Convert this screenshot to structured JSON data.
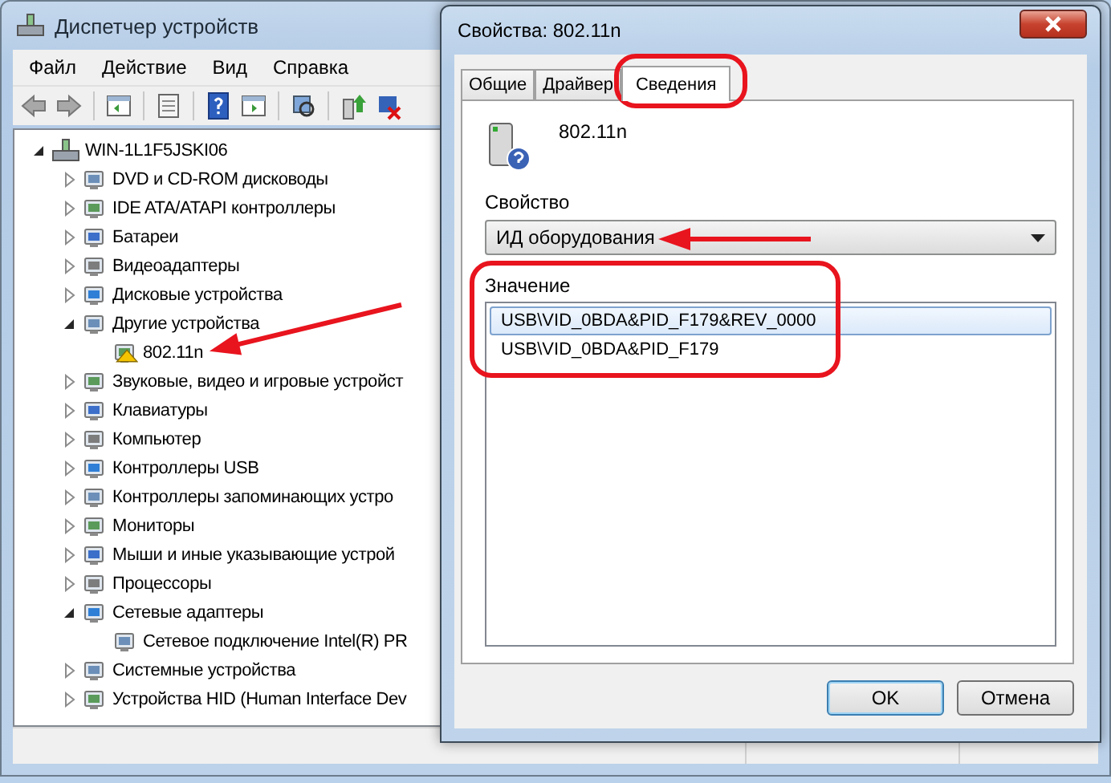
{
  "main_window": {
    "title": "Диспетчер устройств",
    "menu": [
      "Файл",
      "Действие",
      "Вид",
      "Справка"
    ],
    "tree": {
      "label": "WIN-1L1F5JSKI06",
      "expanded": true,
      "children": [
        {
          "label": "DVD и CD-ROM дисководы",
          "expanded": false
        },
        {
          "label": "IDE ATA/ATAPI контроллеры",
          "expanded": false
        },
        {
          "label": "Батареи",
          "expanded": false
        },
        {
          "label": "Видеоадаптеры",
          "expanded": false
        },
        {
          "label": "Дисковые устройства",
          "expanded": false
        },
        {
          "label": "Другие устройства",
          "expanded": true,
          "children": [
            {
              "label": "802.11n",
              "warning": true
            }
          ]
        },
        {
          "label": "Звуковые, видео и игровые устройст",
          "expanded": false
        },
        {
          "label": "Клавиатуры",
          "expanded": false
        },
        {
          "label": "Компьютер",
          "expanded": false
        },
        {
          "label": "Контроллеры USB",
          "expanded": false
        },
        {
          "label": "Контроллеры запоминающих устро",
          "expanded": false
        },
        {
          "label": "Мониторы",
          "expanded": false
        },
        {
          "label": "Мыши и иные указывающие устрой",
          "expanded": false
        },
        {
          "label": "Процессоры",
          "expanded": false
        },
        {
          "label": "Сетевые адаптеры",
          "expanded": true,
          "children": [
            {
              "label": "Сетевое подключение Intel(R) PR",
              "warning": false
            }
          ]
        },
        {
          "label": "Системные устройства",
          "expanded": false
        },
        {
          "label": "Устройства HID (Human Interface Dev",
          "expanded": false
        }
      ]
    }
  },
  "dialog": {
    "title": "Свойства: 802.11n",
    "tabs": [
      {
        "label": "Общие",
        "selected": false
      },
      {
        "label": "Драйвер",
        "selected": false
      },
      {
        "label": "Сведения",
        "selected": true
      }
    ],
    "device_name": "802.11n",
    "property_label": "Свойство",
    "property_value": "ИД оборудования",
    "value_label": "Значение",
    "values": [
      {
        "text": "USB\\VID_0BDA&PID_F179&REV_0000",
        "selected": true
      },
      {
        "text": "USB\\VID_0BDA&PID_F179",
        "selected": false
      }
    ],
    "buttons": [
      "OK",
      "Отмена"
    ]
  }
}
